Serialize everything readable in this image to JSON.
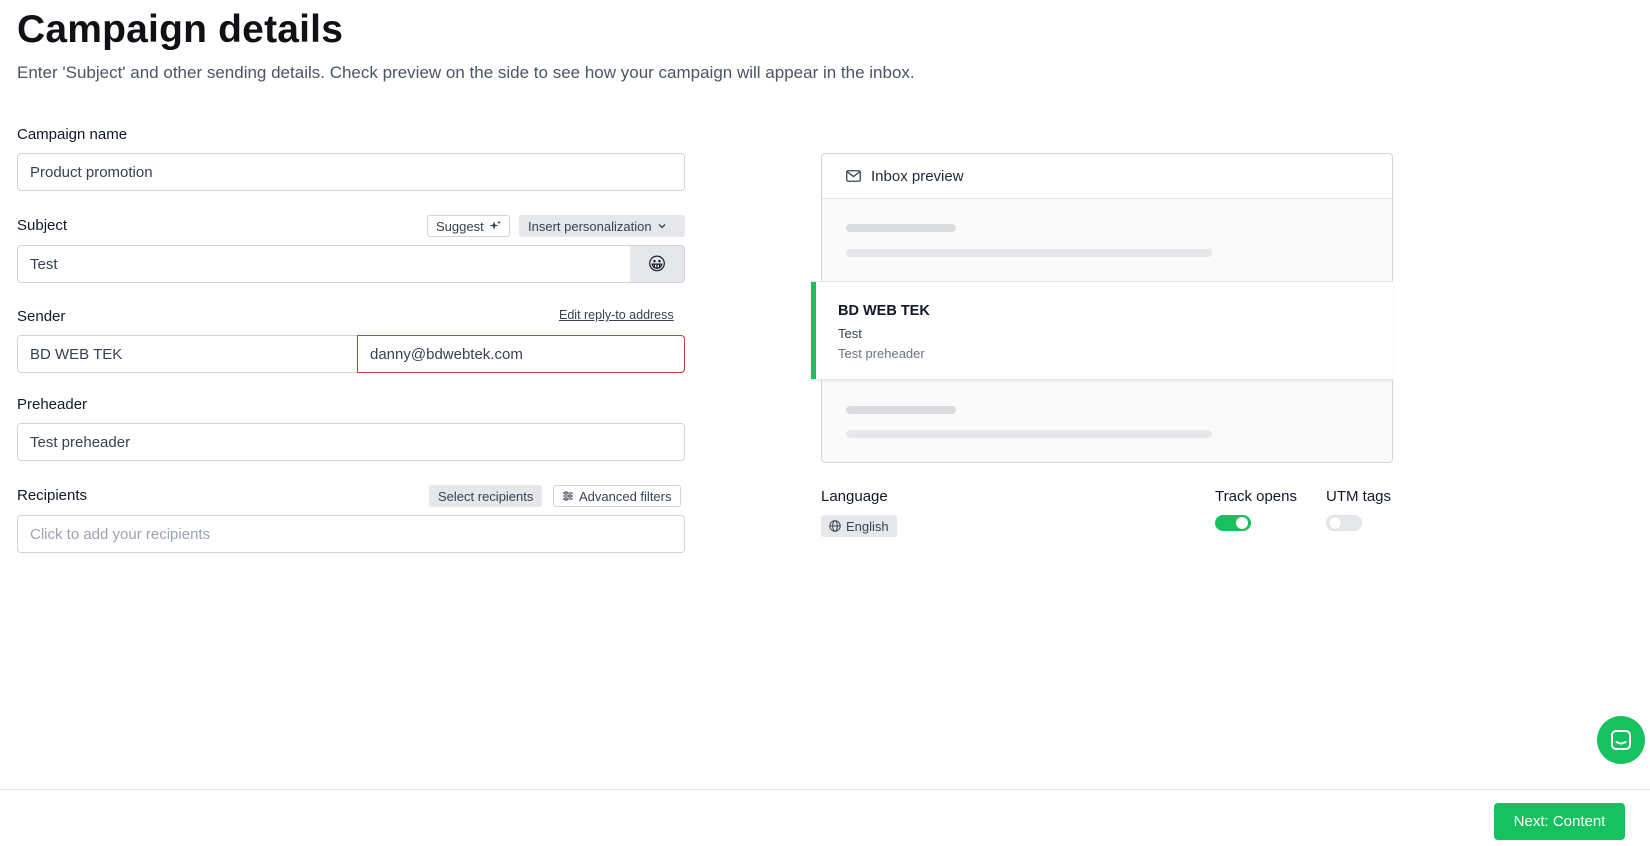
{
  "header": {
    "title": "Campaign details",
    "subtitle": "Enter 'Subject' and other sending details. Check preview on the side to see how your campaign will appear in the inbox."
  },
  "form": {
    "campaign_name": {
      "label": "Campaign name",
      "value": "Product promotion"
    },
    "subject": {
      "label": "Subject",
      "value": "Test",
      "suggest_label": "Suggest",
      "personalization_label": "Insert personalization",
      "emoji": "😀"
    },
    "sender": {
      "label": "Sender",
      "edit_reply_to_label": "Edit reply-to address",
      "name": "BD WEB TEK",
      "email": "danny@bdwebtek.com"
    },
    "preheader": {
      "label": "Preheader",
      "value": "Test preheader"
    },
    "recipients": {
      "label": "Recipients",
      "select_label": "Select recipients",
      "advanced_label": "Advanced filters",
      "placeholder": "Click to add your recipients"
    }
  },
  "preview": {
    "title": "Inbox preview",
    "sender": "BD WEB TEK",
    "subject": "Test",
    "preheader": "Test preheader"
  },
  "settings": {
    "language_label": "Language",
    "language_value": "English",
    "track_opens_label": "Track opens",
    "track_opens_on": true,
    "utm_tags_label": "UTM tags",
    "utm_tags_on": false
  },
  "footer": {
    "next_label": "Next: Content"
  },
  "colors": {
    "accent": "#16c15f",
    "error_border": "#c2413c"
  }
}
